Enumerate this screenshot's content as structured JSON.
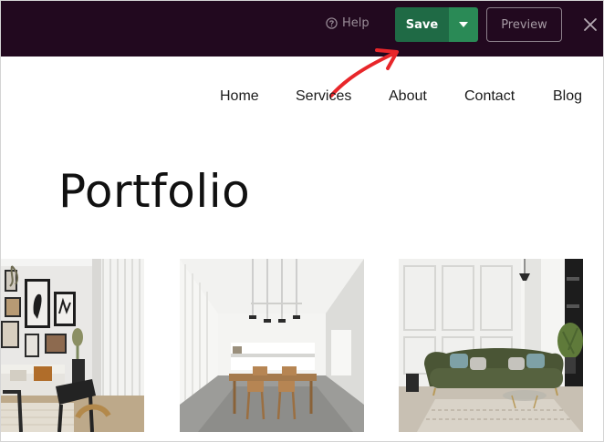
{
  "toolbar": {
    "help_label": "Help",
    "help_icon": "question-circle-icon",
    "save_label": "Save",
    "save_dropdown_icon": "caret-down-icon",
    "preview_label": "Preview",
    "close_icon": "close-icon",
    "colors": {
      "background": "#22091f",
      "save": "#1f6a45",
      "save_dropdown": "#2a8a56",
      "annotation_arrow": "#e8262a"
    }
  },
  "nav": {
    "items": [
      {
        "label": "Home"
      },
      {
        "label": "Services"
      },
      {
        "label": "About"
      },
      {
        "label": "Contact"
      },
      {
        "label": "Blog"
      }
    ]
  },
  "page": {
    "title": "Portfolio"
  },
  "portfolio": {
    "images": [
      {
        "subject": "living room with gallery wall and white curtains"
      },
      {
        "subject": "dining room with wooden table and pendant lights"
      },
      {
        "subject": "living room with green velvet sofa and paneled walls"
      }
    ]
  }
}
